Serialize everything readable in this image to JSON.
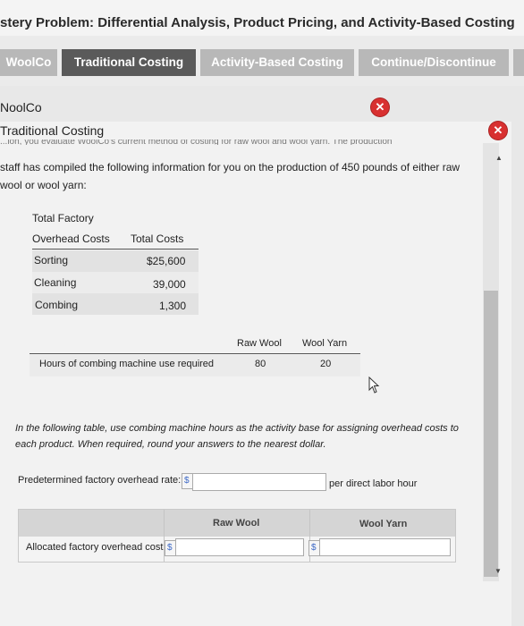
{
  "title": "stery Problem: Differential Analysis, Product Pricing, and Activity-Based Costing",
  "tabs": [
    {
      "label": "WoolCo",
      "active": false
    },
    {
      "label": "Traditional Costing",
      "active": true
    },
    {
      "label": "Activity-Based Costing",
      "active": false
    },
    {
      "label": "Continue/Discontinue",
      "active": false
    }
  ],
  "outer_panel": {
    "title": "NoolCo"
  },
  "inner_panel": {
    "title": "Traditional Costing",
    "cutoff_text": "...ion, you evaluate WoolCo's current method of costing for raw wool and wool yarn. The production",
    "intro": "staff has compiled the following information for you on the production of 450 pounds of either raw wool or wool yarn:"
  },
  "overhead_table": {
    "header_line1": "Total Factory",
    "header_col1": "Overhead Costs",
    "header_col2": "Total Costs",
    "rows": [
      {
        "label": "Sorting",
        "value": "$25,600"
      },
      {
        "label": "Cleaning",
        "value": "39,000"
      },
      {
        "label": "Combing",
        "value": "1,300"
      }
    ]
  },
  "hours_table": {
    "col1": "Raw Wool",
    "col2": "Wool Yarn",
    "row_label": "Hours of combing machine use required",
    "raw_wool": "80",
    "wool_yarn": "20"
  },
  "instruction": "In the following table, use combing machine hours as the activity base for assigning overhead costs to each product. When required, round your answers to the nearest dollar.",
  "rate": {
    "label": "Predetermined factory overhead rate:",
    "currency": "$",
    "value": "",
    "unit": "per direct labor hour"
  },
  "allocation": {
    "col1": "Raw Wool",
    "col2": "Wool Yarn",
    "row_label": "Allocated factory overhead cost",
    "currency": "$",
    "raw_wool_value": "",
    "wool_yarn_value": ""
  },
  "icons": {
    "close": "close-icon",
    "scroll_up": "scroll-up-icon",
    "scroll_down": "scroll-down-icon",
    "cursor": "mouse-cursor-icon"
  },
  "colors": {
    "active_tab": "#5a5a5a",
    "inactive_tab": "#b8b8b8",
    "close": "#d83030",
    "dollar": "#3c68c6"
  }
}
